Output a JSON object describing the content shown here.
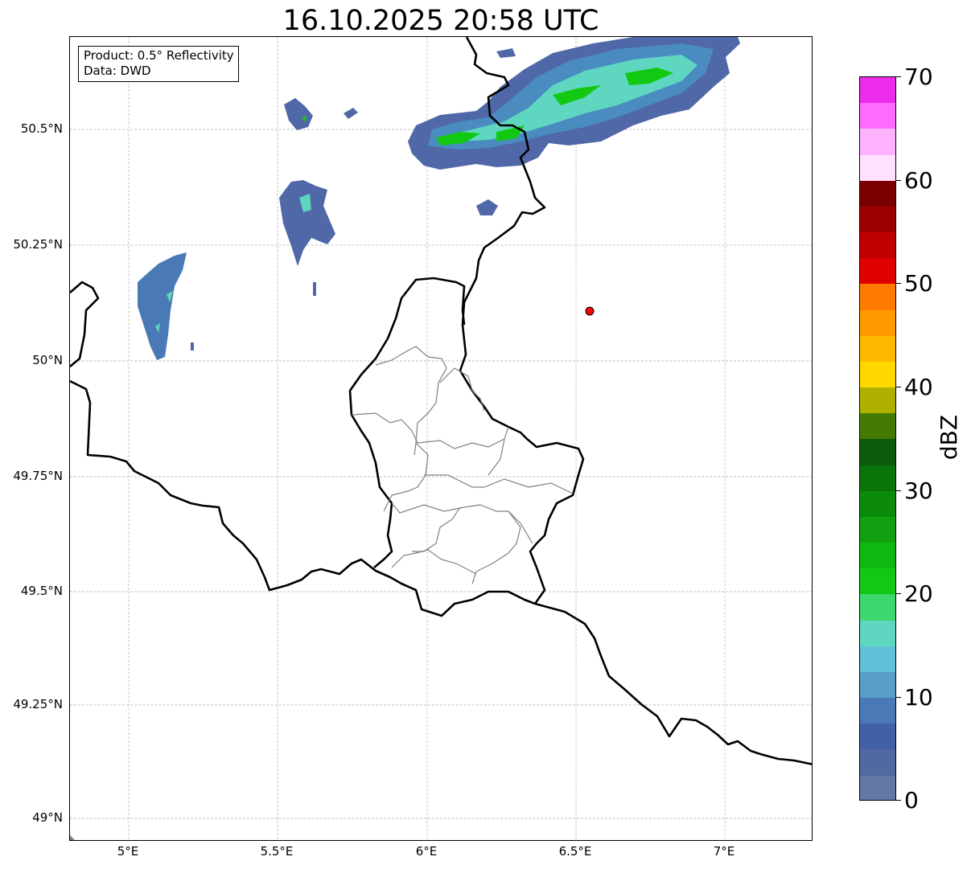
{
  "title": "16.10.2025 20:58 UTC",
  "info_box": {
    "product": "Product: 0.5° Reflectivity",
    "source": "Data: DWD"
  },
  "lat_labels": [
    "50.5°N",
    "50.25°N",
    "50°N",
    "49.75°N",
    "49.5°N",
    "49.25°N",
    "49°N"
  ],
  "lon_labels": [
    "5°E",
    "5.5°E",
    "6°E",
    "6.5°E",
    "7°E"
  ],
  "colorbar": {
    "unit": "dBZ",
    "tick_labels": [
      "70",
      "60",
      "50",
      "40",
      "30",
      "20",
      "10",
      "0"
    ],
    "colors": [
      "#eb2ceb",
      "#ff6bff",
      "#ffb3ff",
      "#ffe0ff",
      "#7a0000",
      "#9e0000",
      "#c00000",
      "#e00000",
      "#ff7a00",
      "#ff9a00",
      "#ffb800",
      "#ffd800",
      "#b0b000",
      "#457a05",
      "#0a5c0a",
      "#0a730a",
      "#0c8a0c",
      "#10a010",
      "#12b812",
      "#12c812",
      "#3ed66e",
      "#5fd6c0",
      "#62c0d8",
      "#5a9ec8",
      "#4a7ab5",
      "#4260a5",
      "#5268a0",
      "#6478a8"
    ]
  },
  "map": {
    "site_marker_color": "#ff0000",
    "border_color": "#000000",
    "district_color": "#808080",
    "grid_color": "#b0b0b0"
  }
}
